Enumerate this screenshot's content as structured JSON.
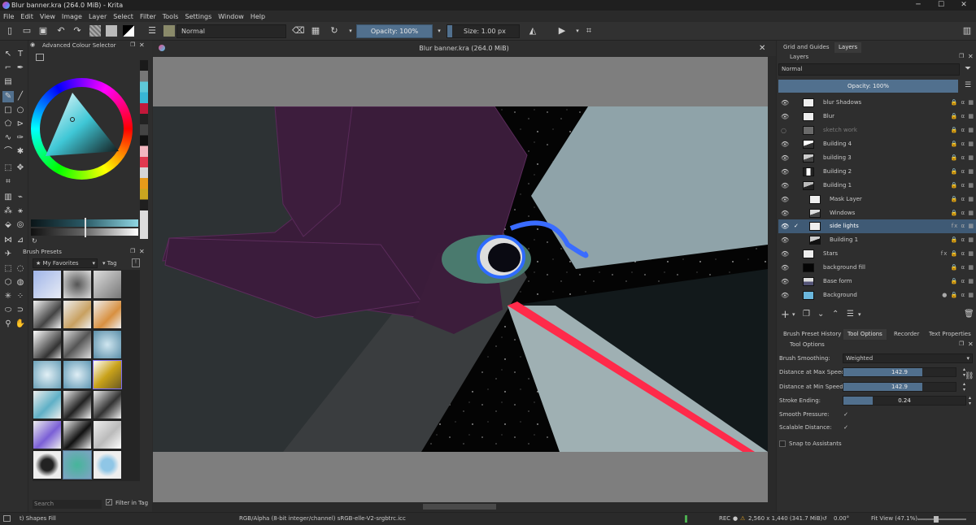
{
  "window": {
    "title": "Blur banner.kra (264.0 MiB) - Krita",
    "document_title": "Blur banner.kra (264.0 MiB)"
  },
  "menu": [
    "File",
    "Edit",
    "View",
    "Image",
    "Layer",
    "Select",
    "Filter",
    "Tools",
    "Settings",
    "Window",
    "Help"
  ],
  "toolbar": {
    "blend_mode": "Normal",
    "opacity": "Opacity: 100%",
    "size": "Size: 1.00 px"
  },
  "left": {
    "color_selector_title": "Advanced Colour Selector",
    "brush_presets_title": "Brush Presets",
    "tag_select": "My Favorites",
    "tag_label": "Tag",
    "search_placeholder": "Search",
    "filter_in_tag": "Filter in Tag"
  },
  "right": {
    "top_tabs": [
      "Grid and Guides",
      "Layers"
    ],
    "layers_title": "Layers",
    "layer_blend_mode": "Normal",
    "layer_opacity": "Opacity: 100%",
    "layers": [
      {
        "name": "blur Shadows"
      },
      {
        "name": "Blur"
      },
      {
        "name": "sketch work"
      },
      {
        "name": "Building 4"
      },
      {
        "name": "building 3"
      },
      {
        "name": "Building 2"
      },
      {
        "name": "Building 1"
      },
      {
        "name": "Mask Layer"
      },
      {
        "name": "Windows"
      },
      {
        "name": "side lights"
      },
      {
        "name": "Building 1"
      },
      {
        "name": "Stars"
      },
      {
        "name": "background fill"
      },
      {
        "name": "Base form"
      },
      {
        "name": "Background"
      }
    ],
    "bottom_tabs": [
      "Brush Preset History",
      "Tool Options",
      "Recorder",
      "Text Properties"
    ],
    "tool_options_title": "Tool Options",
    "brush_smoothing_label": "Brush Smoothing:",
    "brush_smoothing_value": "Weighted",
    "dist_max_label": "Distance at Max Speed:",
    "dist_max_value": "142.9",
    "dist_min_label": "Distance at Min Speed:",
    "dist_min_value": "142.9",
    "stroke_ending_label": "Stroke Ending:",
    "stroke_ending_value": "0.24",
    "smooth_pressure_label": "Smooth Pressure:",
    "scalable_distance_label": "Scalable Distance:",
    "snap_label": "Snap to Assistants"
  },
  "status": {
    "tool": "t) Shapes Fill",
    "color_model": "RGB/Alpha (8-bit integer/channel)  sRGB-elle-V2-srgbtrc.icc",
    "rec": "REC",
    "dimensions": "2,560 x 1,440 (341.7 MiB)",
    "rotation": "0.00°",
    "zoom": "Fit View (47.1%)"
  },
  "colors": {
    "accent": "#51708e",
    "selected_layer": "#3f5a75",
    "canvas_gray": "#7e7e7e"
  }
}
